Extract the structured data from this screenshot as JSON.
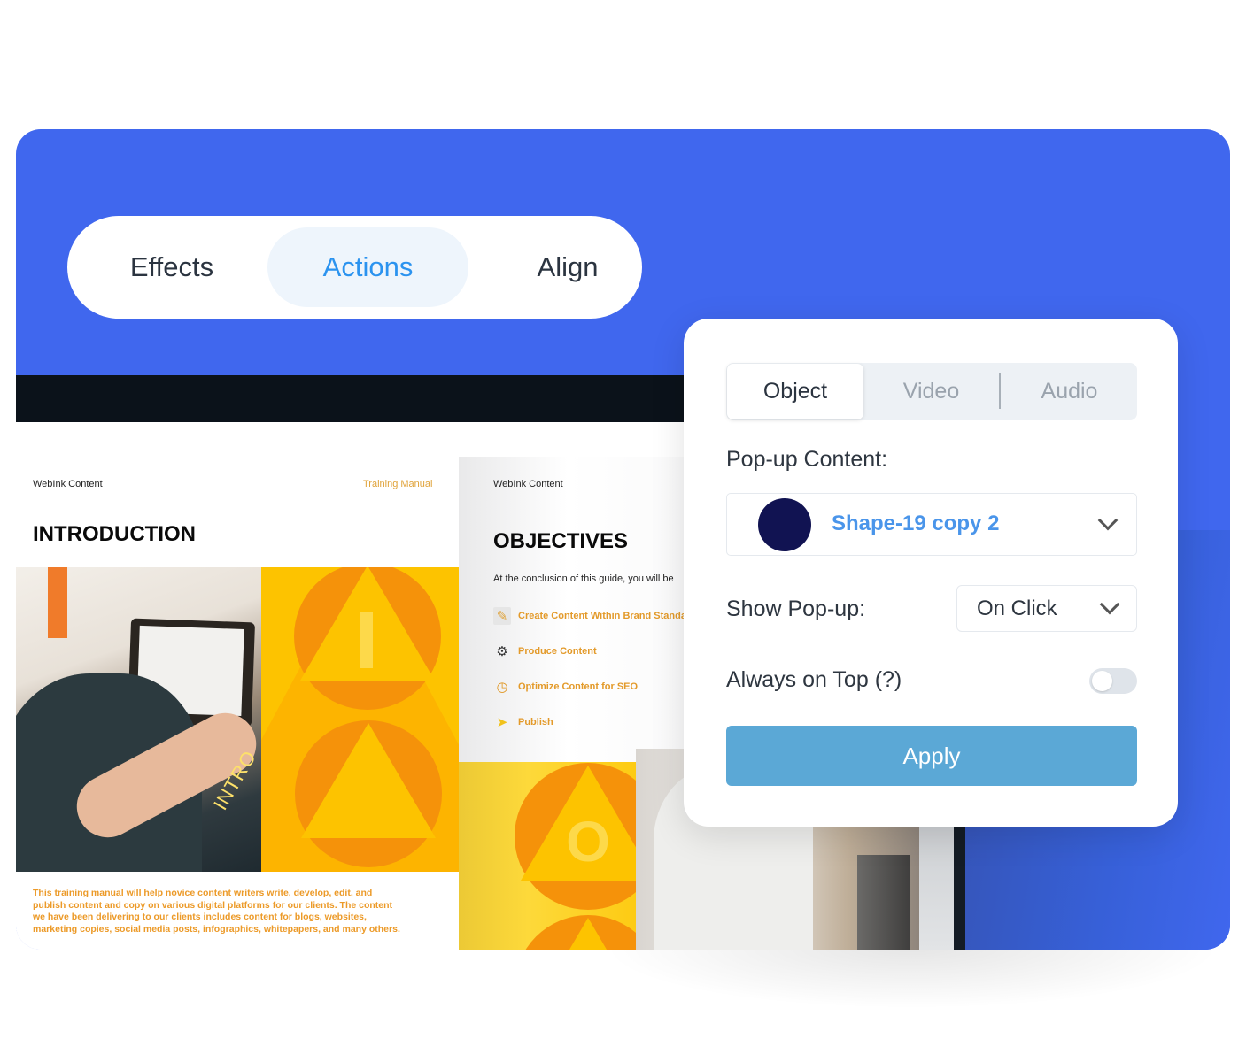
{
  "toolbar": {
    "tabs": [
      {
        "label": "Effects",
        "active": false
      },
      {
        "label": "Actions",
        "active": true
      },
      {
        "label": "Align",
        "active": false
      }
    ]
  },
  "document": {
    "page1": {
      "brand": "WebInk Content",
      "header_right": "Training Manual",
      "title": "INTRODUCTION",
      "image_caption": "INTRO",
      "body": "This training manual will help novice content writers write, develop, edit, and publish content and copy on various digital platforms for our clients. The content we have been delivering to our clients includes content for blogs, websites, marketing copies, social media posts, infographics, whitepapers, and many others.",
      "graphic_letter": "I"
    },
    "page2": {
      "brand": "WebInk Content",
      "title": "OBJECTIVES",
      "intro": "At the conclusion of this guide, you will be",
      "objectives": [
        {
          "icon": "pencil-icon",
          "label": "Create Content Within Brand Standards"
        },
        {
          "icon": "gear-icon",
          "label": "Produce Content"
        },
        {
          "icon": "stopwatch-icon",
          "label": "Optimize Content for SEO"
        },
        {
          "icon": "paper-plane-icon",
          "label": "Publish"
        }
      ],
      "graphic_letter": "O"
    }
  },
  "panel": {
    "segments": [
      {
        "label": "Object",
        "active": true
      },
      {
        "label": "Video",
        "active": false
      },
      {
        "label": "Audio",
        "active": false
      }
    ],
    "popup_content_label": "Pop-up Content:",
    "popup_content_value": "Shape-19 copy 2",
    "popup_swatch_color": "#111352",
    "show_popup_label": "Show Pop-up:",
    "show_popup_value": "On Click",
    "always_on_top_label": "Always on Top (?)",
    "always_on_top": false,
    "apply_label": "Apply"
  },
  "colors": {
    "brand_blue": "#4067ee",
    "accent_blue": "#2b93ef",
    "apply_blue": "#5ba8d6",
    "doc_yellow": "#fdc300",
    "doc_orange": "#f5920a"
  }
}
